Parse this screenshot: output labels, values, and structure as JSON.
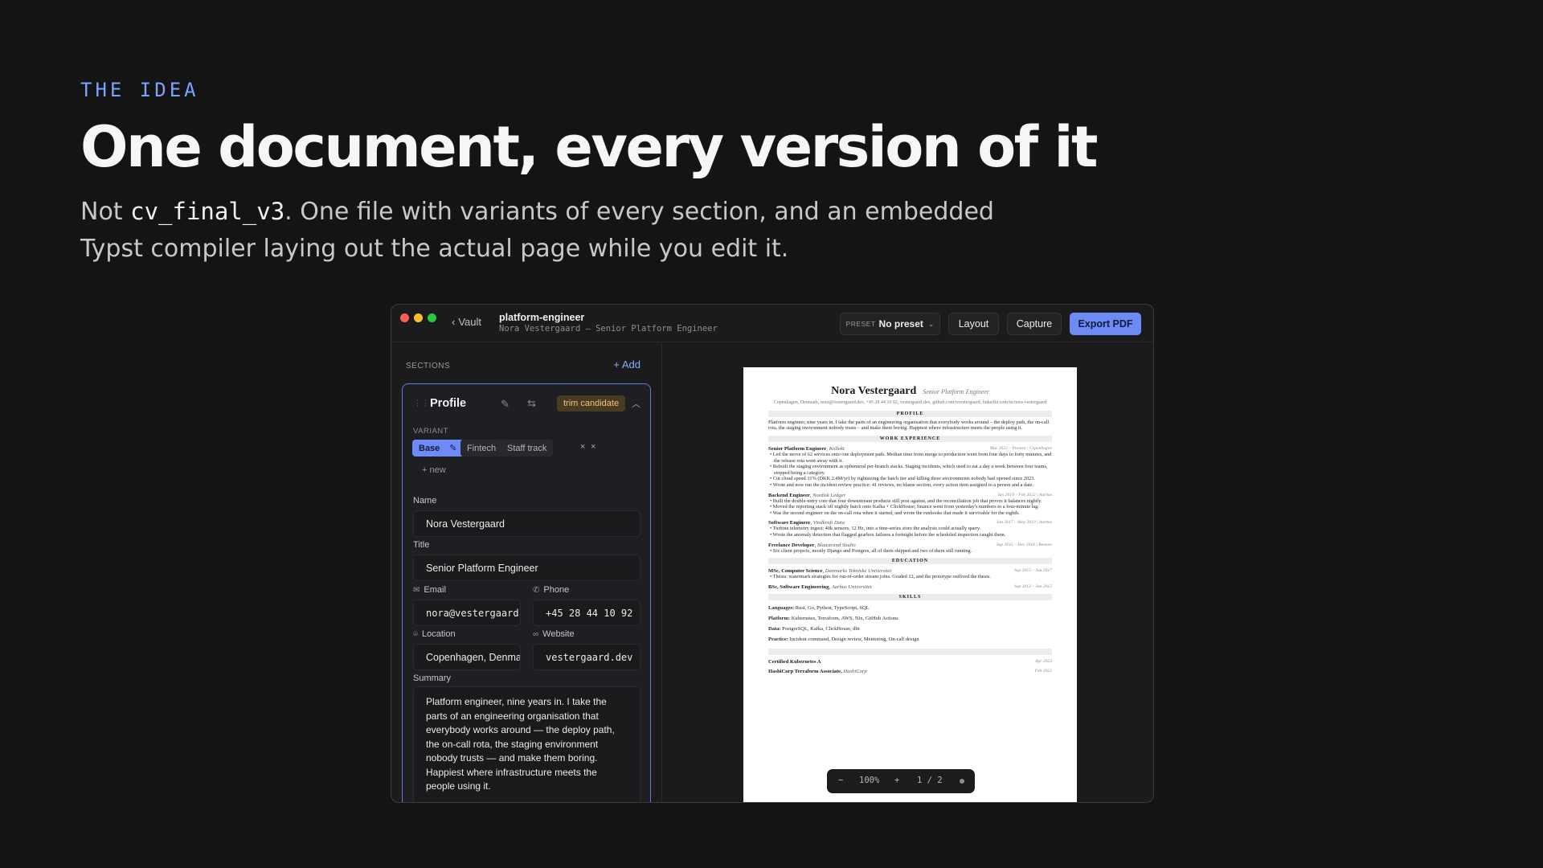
{
  "hero": {
    "eyebrow": "THE IDEA",
    "headline": "One document, every version of it",
    "lede_prefix": "Not ",
    "lede_code": "cv_final_v3",
    "lede_suffix": ". One file with variants of every section, and an embedded Typst compiler laying out the actual page while you edit it."
  },
  "titlebar": {
    "back_label": "Vault",
    "doc_name": "platform-engineer",
    "doc_subtitle": "Nora Vestergaard — Senior Platform Engineer",
    "preset_label": "PRESET",
    "preset_value": "No preset",
    "layout_label": "Layout",
    "capture_label": "Capture",
    "export_label": "Export PDF"
  },
  "sidebar": {
    "sections_label": "SECTIONS",
    "add_label": "+ Add",
    "card": {
      "title": "Profile",
      "badge": "trim candidate",
      "variant_label": "VARIANT",
      "variants": [
        "Base",
        "Fintech",
        "Staff track"
      ],
      "new_variant_label": "+ new",
      "fields": {
        "name_label": "Name",
        "name_value": "Nora Vestergaard",
        "title_label": "Title",
        "title_value": "Senior Platform Engineer",
        "email_label": "Email",
        "email_value": "nora@vestergaard.dev",
        "phone_label": "Phone",
        "phone_value": "+45 28 44 10 92",
        "location_label": "Location",
        "location_value": "Copenhagen, Denmark",
        "website_label": "Website",
        "website_value": "vestergaard.dev",
        "summary_label": "Summary",
        "summary_value": "Platform engineer, nine years in. I take the parts of an engineering organisation that everybody works around — the deploy path, the on-call rota, the staging environment nobody trusts — and make them boring. Happiest where infrastructure meets the people using it."
      }
    }
  },
  "preview": {
    "name": "Nora Vestergaard",
    "role": "Senior Platform Engineer",
    "contact": "Copenhagen, Denmark, nora@vestergaard.dev, +45 28 44 10 92, vestergaard.dev, github.com/nvestergaard, linkedin.com/in/nora-vestergaard",
    "sections": {
      "profile": "PROFILE",
      "work": "WORK EXPERIENCE",
      "education": "EDUCATION",
      "skills": "SKILLS"
    },
    "profile_text": "Platform engineer, nine years in. I take the parts of an engineering organisation that everybody works around – the deploy path, the on-call rota, the staging environment nobody trusts – and make them boring. Happiest where infrastructure meets the people using it.",
    "jobs": [
      {
        "title": "Senior Platform Engineer",
        "company": "Kollekt",
        "dates": "Mar 2022 – Present | Copenhagen",
        "bullets": [
          "Led the move of 62 services onto one deployment path. Median time from merge to production went from four days to forty minutes, and the release rota went away with it.",
          "Rebuilt the staging environment as ephemeral per-branch stacks. Staging incidents, which used to eat a day a week between four teams, stopped being a category.",
          "Cut cloud spend 31% (DKK 2.4M/yr) by rightsizing the batch tier and killing three environments nobody had opened since 2023.",
          "Wrote and now run the incident review practice: 41 reviews, no blame section, every action item assigned to a person and a date."
        ]
      },
      {
        "title": "Backend Engineer",
        "company": "Nordisk Ledger",
        "dates": "Jun 2019 – Feb 2022 | Aarhus",
        "bullets": [
          "Built the double-entry core that four downstream products still post against, and the reconciliation job that proves it balances nightly.",
          "Moved the reporting stack off nightly batch onto Kafka + ClickHouse; finance went from yesterday's numbers to a four-minute lag.",
          "Was the second engineer on the on-call rota when it started, and wrote the runbooks that made it survivable for the eighth."
        ]
      },
      {
        "title": "Software Engineer",
        "company": "Vindkraft Data",
        "dates": "Jan 2017 – May 2019 | Aarhus",
        "bullets": [
          "Turbine telemetry ingest: 40k sensors, 12 Hz, into a time-series store the analysts could actually query.",
          "Wrote the anomaly detection that flagged gearbox failures a fortnight before the scheduled inspection caught them."
        ]
      },
      {
        "title": "Freelance Developer",
        "company": "Blaastrand Studio",
        "dates": "Sep 2015 – Dec 2016 | Remote",
        "bullets": [
          "Six client projects, mostly Django and Postgres, all of them shipped and two of them still running."
        ]
      }
    ],
    "education": [
      {
        "title": "MSc, Computer Science",
        "school": "Danmarks Tekniske Universitet",
        "dates": "Sep 2015 – Jun 2017",
        "bullets": [
          "Thesis: watermark strategies for out-of-order stream joins. Graded 12, and the prototype outlived the thesis."
        ]
      },
      {
        "title": "BSc, Software Engineering",
        "school": "Aarhus Universitet",
        "dates": "Sep 2012 – Jun 2015",
        "bullets": []
      }
    ],
    "skills": [
      {
        "label": "Languages:",
        "value": "Rust, Go, Python, TypeScript, SQL"
      },
      {
        "label": "Platform:",
        "value": "Kubernetes, Terraform, AWS, Nix, GitHub Actions"
      },
      {
        "label": "Data:",
        "value": "PostgreSQL, Kafka, ClickHouse, dbt"
      },
      {
        "label": "Practice:",
        "value": "Incident command, Design review, Mentoring, On-call design"
      }
    ],
    "certs": [
      {
        "title": "Certified Kubernetes A",
        "org": "",
        "dates": "Apr 2023"
      },
      {
        "title": "HashiCorp Terraform Associate,",
        "org": "HashiCorp",
        "dates": "Feb 2022"
      }
    ],
    "zoom": {
      "minus": "−",
      "level": "100%",
      "plus": "+",
      "page": "1 / 2"
    }
  },
  "colors": {
    "accent": "#6e8bf5",
    "eyebrow": "#7ea2ff",
    "badge_bg": "#4a3c22",
    "badge_fg": "#f0c27a",
    "traffic_red": "#ff5f57",
    "traffic_yellow": "#febc2e",
    "traffic_green": "#28c840"
  }
}
